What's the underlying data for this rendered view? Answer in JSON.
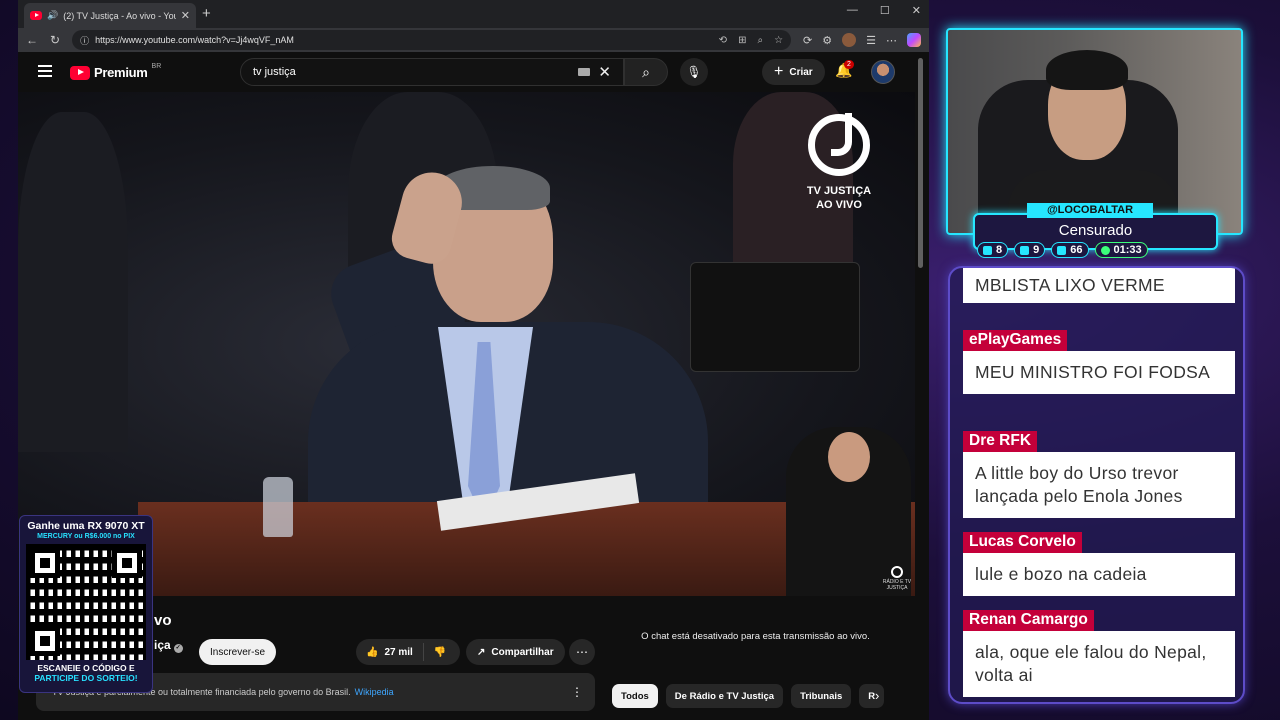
{
  "browser": {
    "tab_title": "(2) TV Justiça - Ao vivo - You",
    "url": "https://www.youtube.com/watch?v=Jj4wqVF_nAM"
  },
  "youtube": {
    "logo_text": "Premium",
    "region": "BR",
    "search_value": "tv justiça",
    "create_label": "Criar",
    "notification_count": "2",
    "video_logo_line1": "TV JUSTIÇA",
    "video_logo_line2": "AO VIVO",
    "video_small_logo": "RÁDIO E TV JUSTIÇA",
    "title_fragment": "vo",
    "channel_fragment": "iça",
    "subscribe_label": "Inscrever-se",
    "likes": "27 mil",
    "share_label": "Compartilhar",
    "info_text": "TV Justiça é parcialmente ou totalmente financiada pelo governo do Brasil.",
    "info_link": "Wikipedia",
    "chat_disabled": "O chat está desativado para esta transmissão ao vivo.",
    "chips": [
      "Todos",
      "De Rádio e TV Justiça",
      "Tribunais",
      "R"
    ]
  },
  "qr_promo": {
    "line1": "Ganhe uma RX 9070 XT",
    "line2": "MERCURY ou R$6.000 no PIX",
    "line3": "ESCANEIE O CÓDIGO E",
    "line4": "PARTICIPE DO SORTEIO!"
  },
  "stream": {
    "handle": "@LOCOBALTAR",
    "status": "Censurado",
    "stats": [
      {
        "icon": "twitch-icon",
        "value": "8"
      },
      {
        "icon": "youtube-icon",
        "value": "9"
      },
      {
        "icon": "kick-icon",
        "value": "66"
      },
      {
        "icon": "clock-icon",
        "value": "01:33"
      }
    ]
  },
  "chat": {
    "messages": [
      {
        "user": "",
        "text": "MBLISTA LIXO VERME"
      },
      {
        "user": "ePlayGames",
        "text": "MEU MINISTRO FOI FODSA"
      },
      {
        "user": "Dre RFK",
        "text": "A little boy do Urso trevor lançada pelo Enola Jones"
      },
      {
        "user": "Lucas Corvelo",
        "text": "lule e bozo na cadeia"
      },
      {
        "user": "Renan Camargo",
        "text": "ala, oque ele falou do Nepal, volta ai"
      }
    ]
  },
  "colors": {
    "accent_cyan": "#26e6ff",
    "chat_user_bg": "#c4003a",
    "youtube_red": "#ff0033"
  }
}
